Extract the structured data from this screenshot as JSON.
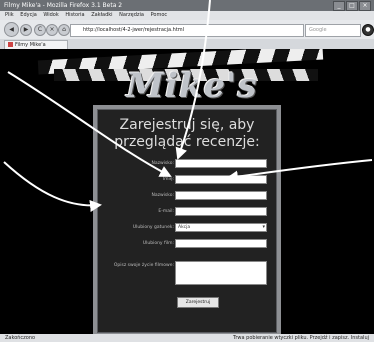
{
  "window": {
    "title": "Filmy Mike'a - Mozilla Firefox 3.1 Beta 2",
    "controls": [
      "_",
      "□",
      "×"
    ]
  },
  "menu": [
    "Plik",
    "Edycja",
    "Widok",
    "Historia",
    "Zakładki",
    "Narzędzia",
    "Pomoc"
  ],
  "nav": {
    "back": "◀",
    "forward": "▶",
    "reload": "C",
    "stop": "×",
    "home": "⌂",
    "url": "http://localhost/4-2-jwer/rejestracja.html",
    "search_placeholder": "Google"
  },
  "tabs": [
    {
      "label": "Filmy Mike'a"
    }
  ],
  "site": {
    "logo": "Mike's Movies",
    "heading": "Zarejestruj się, aby przeglądać recenzje:",
    "fields": [
      {
        "label": "Nazwisko:",
        "type": "text",
        "value": ""
      },
      {
        "label": "Imię:",
        "type": "text",
        "value": ""
      },
      {
        "label": "Nazwisko:",
        "type": "text",
        "value": ""
      },
      {
        "label": "E-mail:",
        "type": "text",
        "value": ""
      },
      {
        "label": "Ulubiony gatunek:",
        "type": "select",
        "value": "Akcja"
      },
      {
        "label": "Ulubiony film:",
        "type": "text",
        "value": ""
      }
    ],
    "textarea_label": "Opisz swoje życie filmowe:",
    "submit_label": "Zarejestruj"
  },
  "status": {
    "left": "Zakończono",
    "right": "Trwa pobieranie wtyczki pliku. Przejdź i zapisz. Instaluj"
  }
}
